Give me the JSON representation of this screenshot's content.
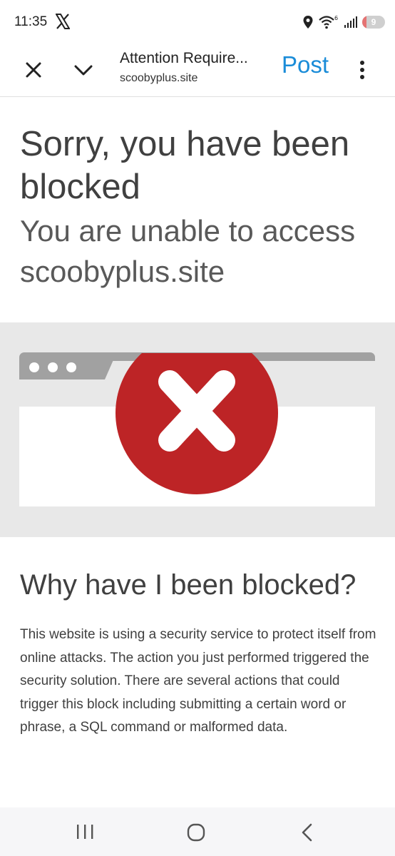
{
  "status_bar": {
    "time": "11:35",
    "app_icon": "x-logo-icon",
    "wifi_badge": "6",
    "battery_level": "9",
    "battery_fraction": 0.09
  },
  "toolbar": {
    "close_icon": "close-icon",
    "chevron_icon": "chevron-down-icon",
    "title": "Attention Require...",
    "url": "scoobyplus.site",
    "post_label": "Post",
    "post_color": "#1a8cd8",
    "more_icon": "more-vertical-icon"
  },
  "page": {
    "heading": "Sorry, you have been blocked",
    "subheading": "You are unable to access scoobyplus.site",
    "illustration": {
      "block_icon": "blocked-x-icon",
      "block_color": "#bd2426",
      "frame_color": "#a1a1a1"
    },
    "why_title": "Why have I been blocked?",
    "why_body": "This website is using a security service to protect itself from online attacks. The action you just performed triggered the security solution. There are several actions that could trigger this block including submitting a certain word or phrase, a SQL command or malformed data."
  },
  "nav_bar": {
    "recent_icon": "recent-apps-icon",
    "home_icon": "home-icon",
    "back_icon": "back-icon"
  }
}
